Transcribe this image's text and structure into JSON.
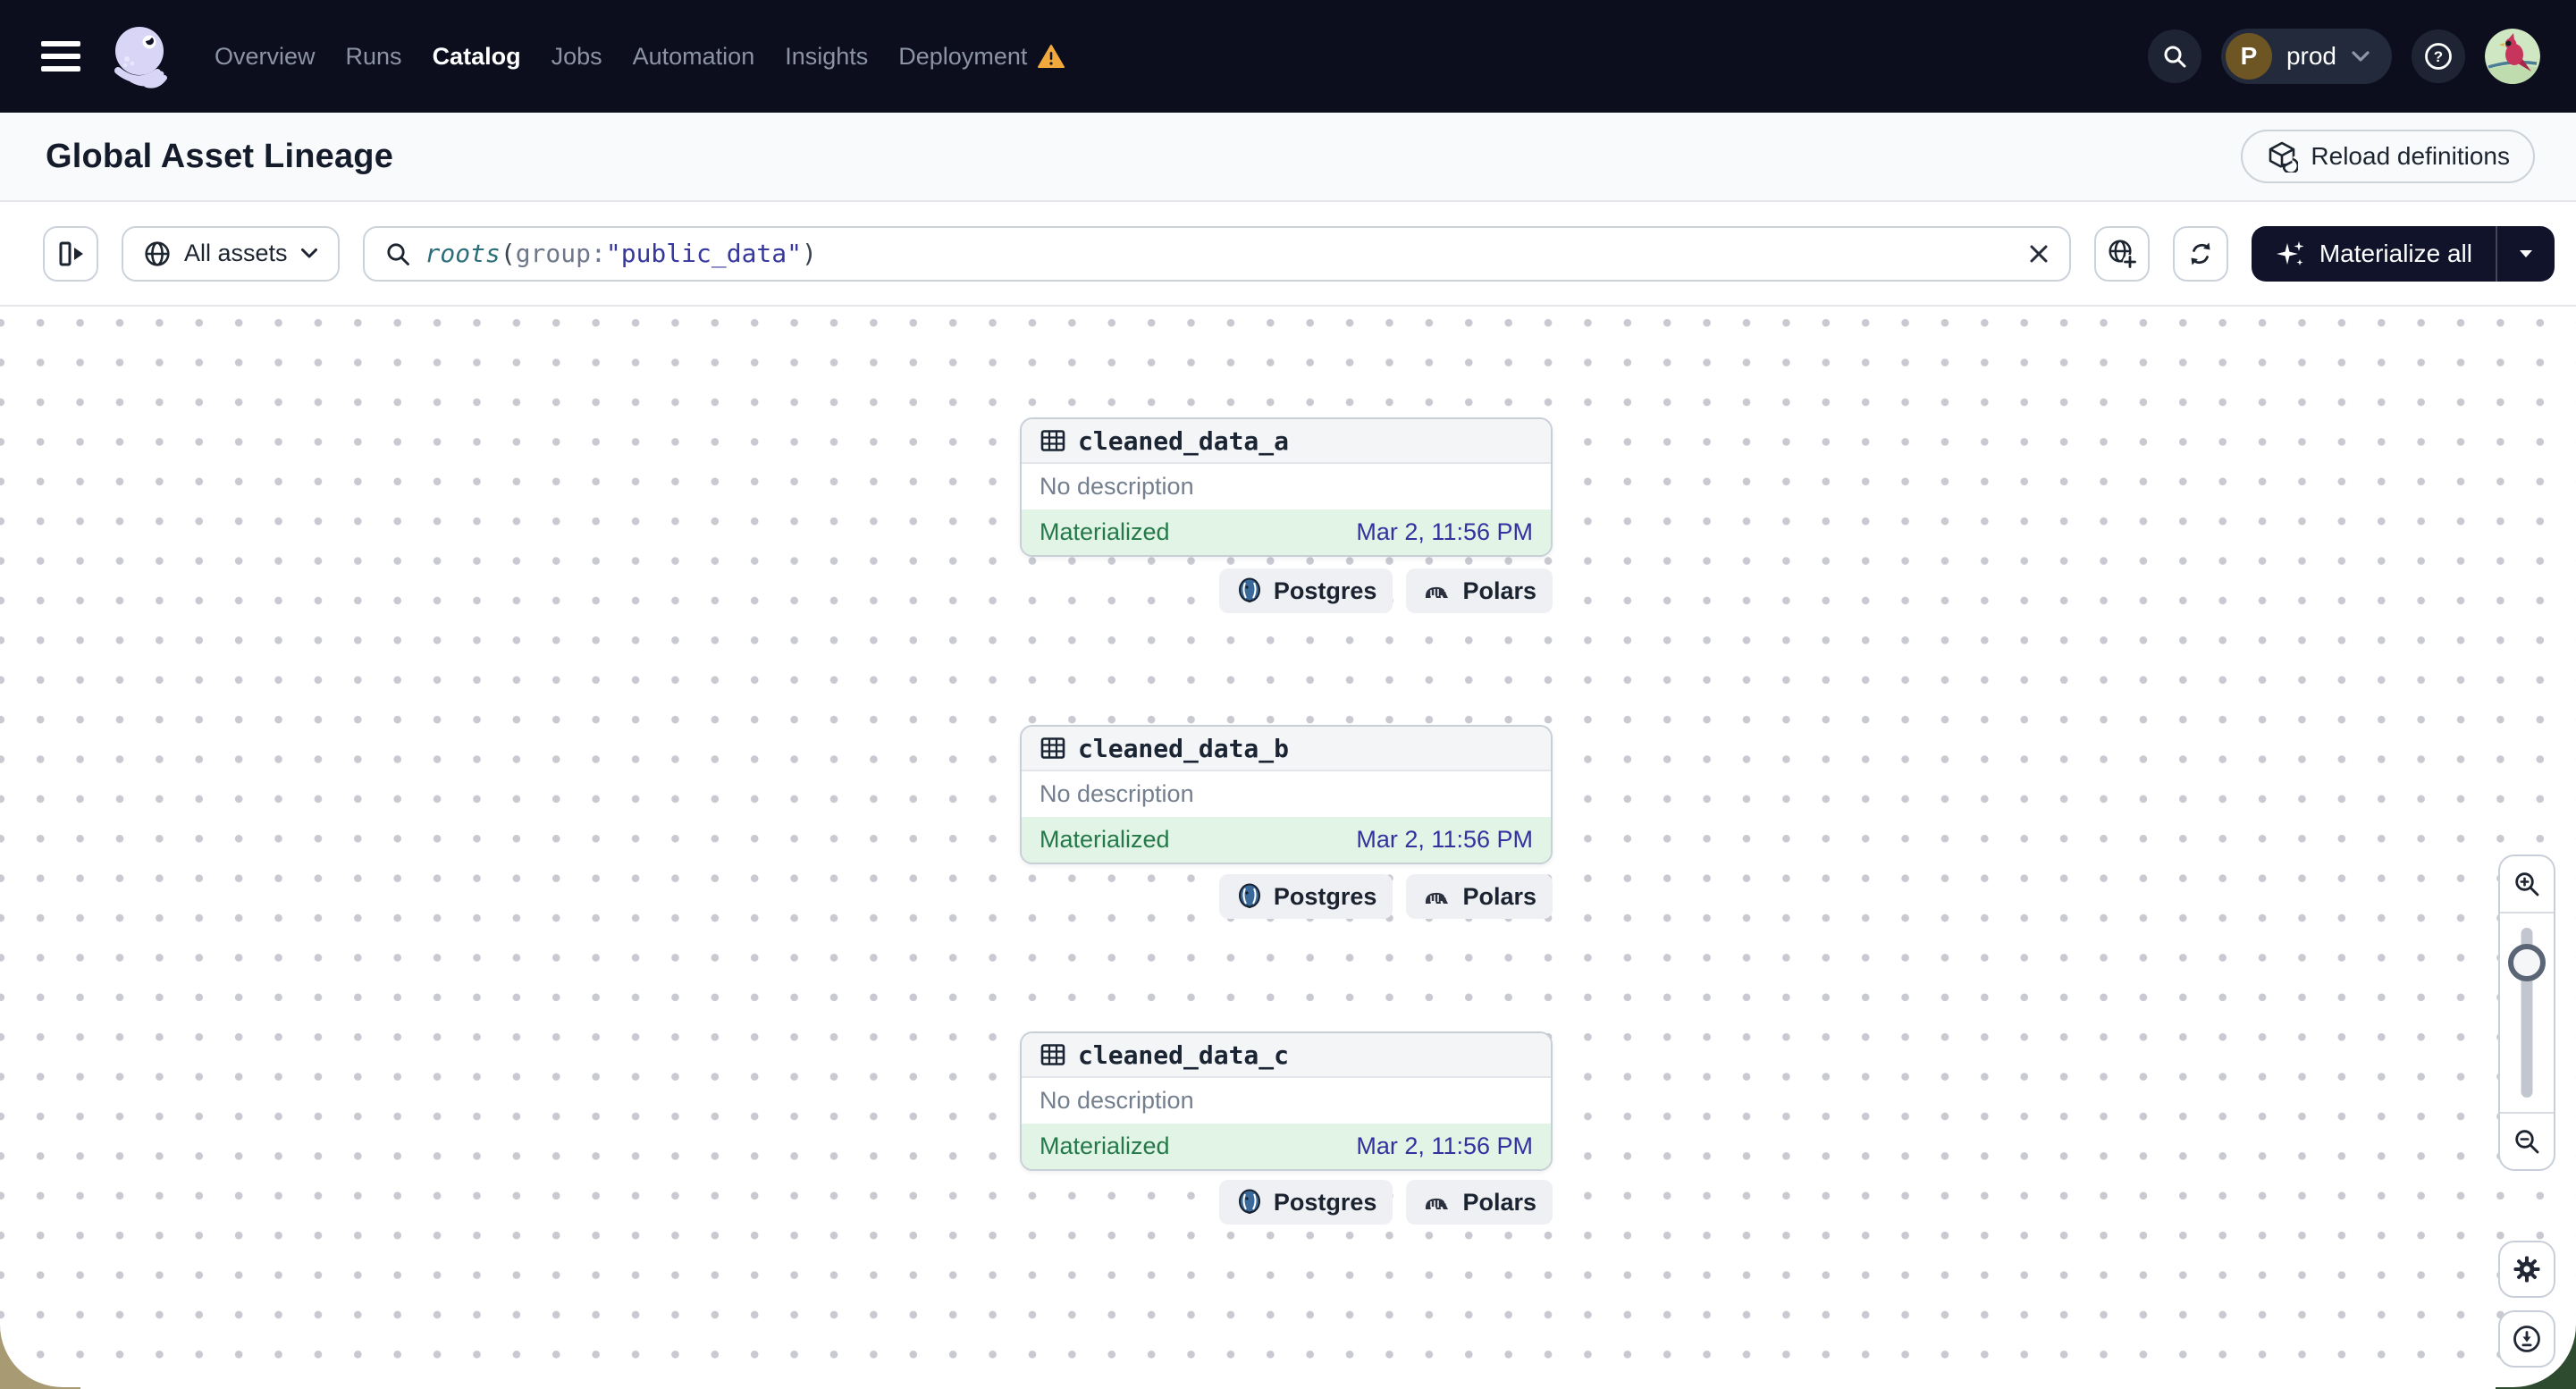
{
  "navbar": {
    "menu_icon": "hamburger-icon",
    "logo_icon": "dagster-octopus-logo",
    "items": [
      {
        "label": "Overview",
        "active": false
      },
      {
        "label": "Runs",
        "active": false
      },
      {
        "label": "Catalog",
        "active": true
      },
      {
        "label": "Jobs",
        "active": false
      },
      {
        "label": "Automation",
        "active": false
      },
      {
        "label": "Insights",
        "active": false
      },
      {
        "label": "Deployment",
        "active": false,
        "warning": true
      }
    ],
    "warning_icon": "warning-triangle-icon",
    "search_icon": "search-icon",
    "deployment_switcher": {
      "initial": "P",
      "label": "prod",
      "initial_bg": "#6d5524",
      "caret_icon": "chevron-down-icon"
    },
    "help_icon": "help-icon",
    "avatar": "user-avatar-cardinal-bird"
  },
  "header": {
    "title": "Global Asset Lineage",
    "reload_button": {
      "label": "Reload definitions",
      "icon": "reload-definitions-icon"
    }
  },
  "toolbar": {
    "panel_toggle_icon": "open-left-panel-icon",
    "scope_selector": {
      "icon": "globe-icon",
      "label": "All assets",
      "caret_icon": "chevron-down-icon"
    },
    "search": {
      "icon": "search-icon",
      "clear_icon": "clear-icon",
      "query_segments": [
        {
          "text": "roots",
          "type": "function"
        },
        {
          "text": "(",
          "type": "punctuation"
        },
        {
          "text": "group:",
          "type": "attribute"
        },
        {
          "text": "\"public_data\"",
          "type": "value"
        },
        {
          "text": ")",
          "type": "punctuation"
        }
      ]
    },
    "actions": {
      "globe_add_icon": "globe-plus-icon",
      "refresh_icon": "refresh-icon"
    },
    "materialize": {
      "label": "Materialize all",
      "icon": "sparkles-icon",
      "caret_icon": "chevron-down-icon",
      "bg": "#10132a"
    }
  },
  "assets": [
    {
      "name": "cleaned_data_a",
      "icon": "table-icon",
      "description": "No description",
      "status": "Materialized",
      "timestamp": "Mar 2, 11:56 PM",
      "tags": [
        {
          "label": "Postgres",
          "icon": "postgres-icon"
        },
        {
          "label": "Polars",
          "icon": "polars-icon"
        }
      ]
    },
    {
      "name": "cleaned_data_b",
      "icon": "table-icon",
      "description": "No description",
      "status": "Materialized",
      "timestamp": "Mar 2, 11:56 PM",
      "tags": [
        {
          "label": "Postgres",
          "icon": "postgres-icon"
        },
        {
          "label": "Polars",
          "icon": "polars-icon"
        }
      ]
    },
    {
      "name": "cleaned_data_c",
      "icon": "table-icon",
      "description": "No description",
      "status": "Materialized",
      "timestamp": "Mar 2, 11:56 PM",
      "tags": [
        {
          "label": "Postgres",
          "icon": "postgres-icon"
        },
        {
          "label": "Polars",
          "icon": "polars-icon"
        }
      ]
    }
  ],
  "status_colors": {
    "materialized_bg": "#e2f4e6",
    "materialized_text": "#237a48",
    "timestamp_text": "#34319f"
  },
  "zoom_controls": {
    "zoom_in_icon": "zoom-in-icon",
    "zoom_out_icon": "zoom-out-icon",
    "slider": "zoom-slider"
  },
  "canvas_controls": {
    "settings_icon": "gear-icon",
    "download_icon": "download-icon"
  }
}
